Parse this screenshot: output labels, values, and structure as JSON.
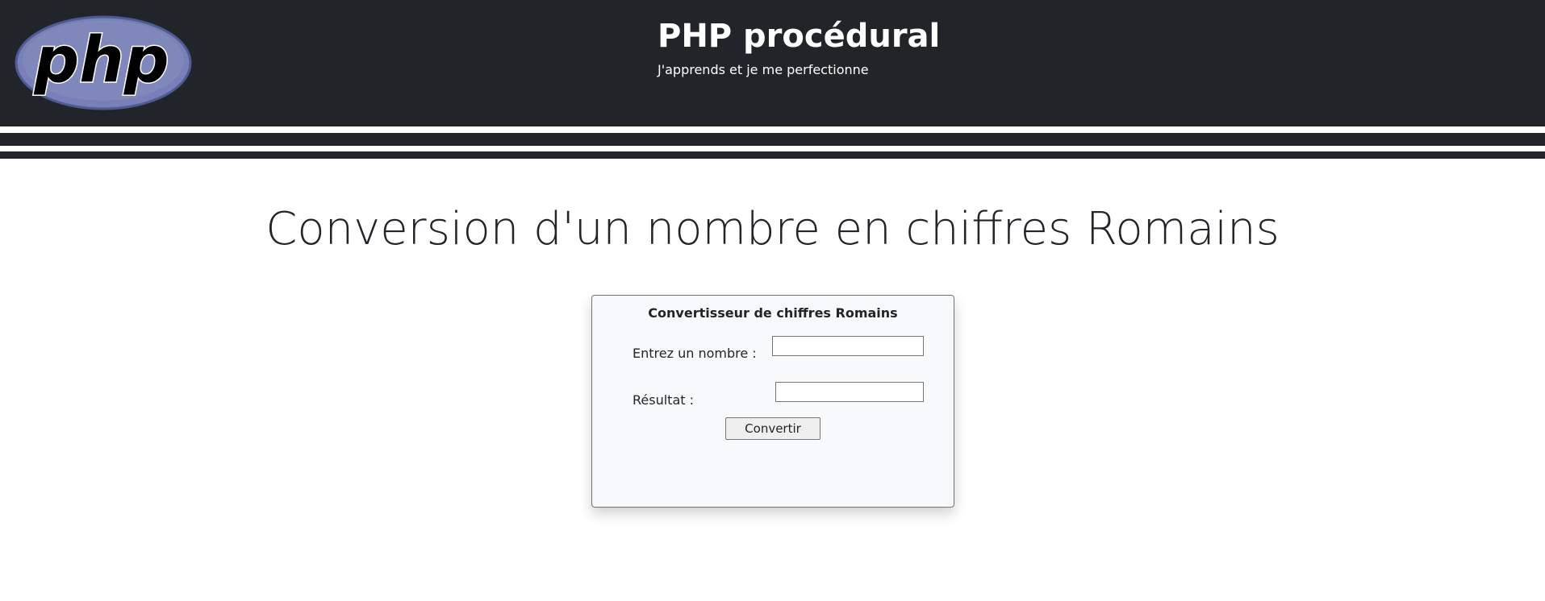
{
  "header": {
    "logo_text": "php",
    "title": "PHP procédural",
    "subtitle": "J'apprends et je me perfectionne"
  },
  "main": {
    "title": "Conversion d'un nombre en chiffres Romains"
  },
  "converter": {
    "title": "Convertisseur de chiffres Romains",
    "number_label": "Entrez un nombre :",
    "number_value": "",
    "result_label": "Résultat :",
    "result_value": "",
    "button_label": "Convertir"
  },
  "colors": {
    "header_bg": "#212529",
    "logo_fill": "#7a7fb8",
    "panel_bg": "#f8f9fa"
  }
}
